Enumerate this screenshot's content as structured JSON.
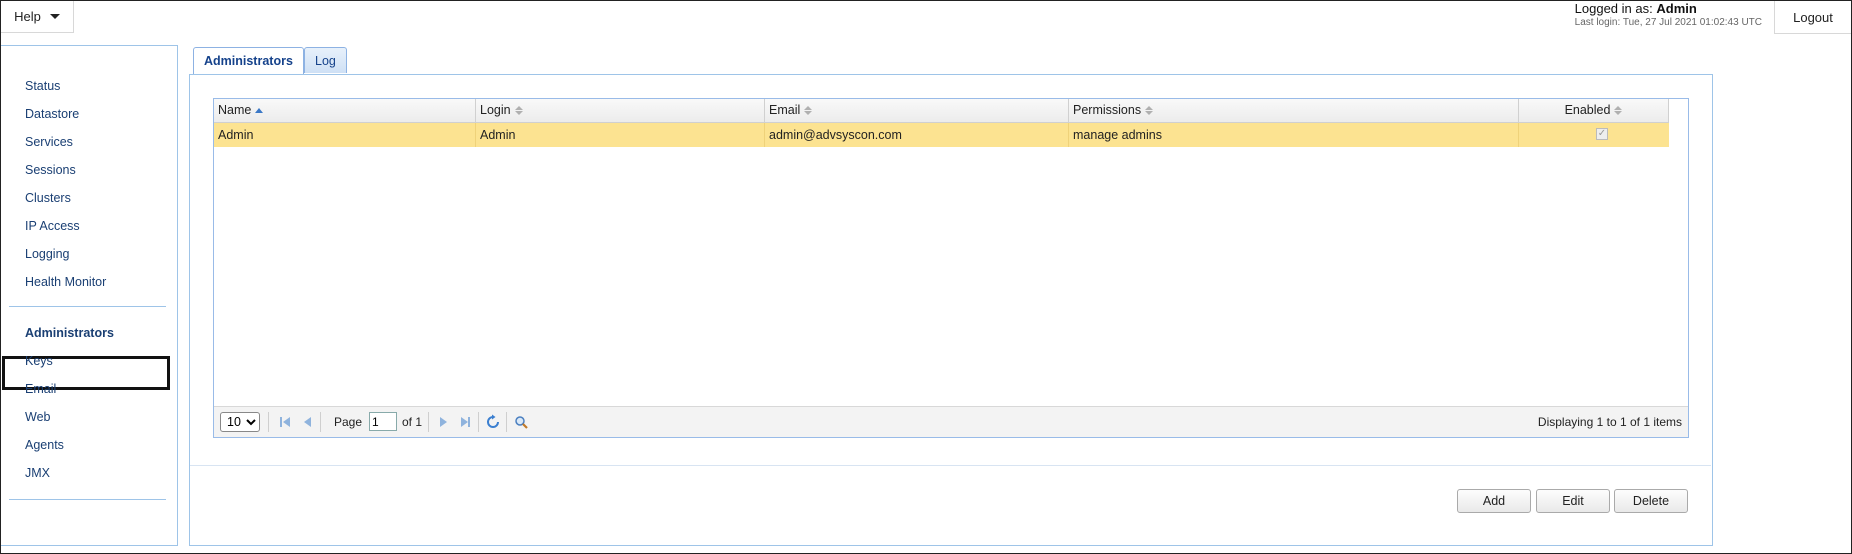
{
  "header": {
    "help_label": "Help",
    "logged_in_prefix": "Logged in as:",
    "user": "Admin",
    "last_login": "Last login: Tue, 27 Jul 2021 01:02:43 UTC",
    "logout_label": "Logout"
  },
  "sidebar": {
    "group1": [
      "Status",
      "Datastore",
      "Services",
      "Sessions",
      "Clusters",
      "IP Access",
      "Logging",
      "Health Monitor"
    ],
    "group2": [
      "Administrators",
      "Keys",
      "Email",
      "Web",
      "Agents",
      "JMX"
    ],
    "active": "Administrators"
  },
  "tabs": [
    "Administrators",
    "Log"
  ],
  "active_tab": "Administrators",
  "grid": {
    "columns": [
      "Name",
      "Login",
      "Email",
      "Permissions",
      "Enabled"
    ],
    "sorted_column": "Name",
    "rows": [
      {
        "name": "Admin",
        "login": "Admin",
        "email": "admin@advsyscon.com",
        "permissions": "manage admins",
        "enabled": true
      }
    ]
  },
  "pager": {
    "page_size": "10",
    "page_size_options": [
      "10"
    ],
    "page_label": "Page",
    "page": "1",
    "of_label": "of 1",
    "info": "Displaying 1 to 1 of 1 items"
  },
  "actions": {
    "add": "Add",
    "edit": "Edit",
    "delete": "Delete"
  },
  "colors": {
    "selected_row": "#fce391",
    "link": "#1a3f73",
    "border": "#9ec4e8"
  }
}
